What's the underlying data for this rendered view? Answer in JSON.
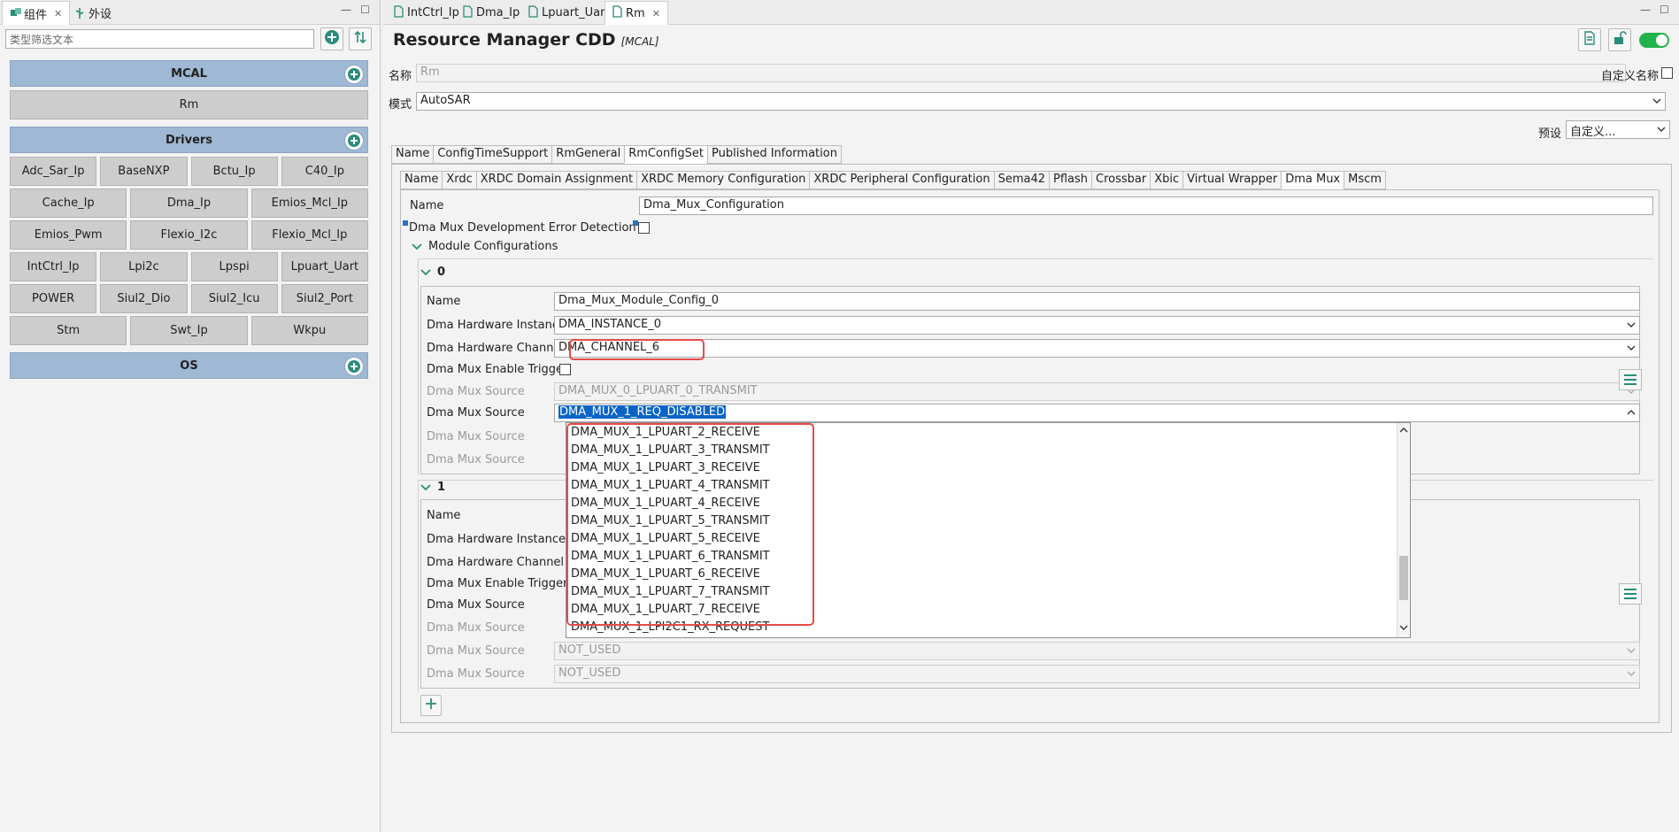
{
  "left_panel": {
    "tabs": [
      {
        "label": "组件",
        "active": true
      },
      {
        "label": "外设",
        "active": false
      }
    ],
    "filter_placeholder": "类型筛选文本",
    "groups": [
      {
        "label": "MCAL",
        "items": [
          [
            "Rm"
          ]
        ]
      },
      {
        "label": "Drivers",
        "items": [
          [
            "Adc_Sar_Ip",
            "BaseNXP",
            "Bctu_Ip",
            "C40_Ip"
          ],
          [
            "Cache_Ip",
            "Dma_Ip",
            "Emios_Mcl_Ip"
          ],
          [
            "Emios_Pwm",
            "Flexio_I2c",
            "Flexio_Mcl_Ip"
          ],
          [
            "IntCtrl_Ip",
            "Lpi2c",
            "Lpspi",
            "Lpuart_Uart"
          ],
          [
            "POWER",
            "Siul2_Dio",
            "Siul2_Icu",
            "Siul2_Port"
          ],
          [
            "Stm",
            "Swt_Ip",
            "Wkpu"
          ]
        ]
      },
      {
        "label": "OS",
        "items": []
      }
    ]
  },
  "editor_tabs": [
    {
      "label": "IntCtrl_Ip",
      "active": false
    },
    {
      "label": "Dma_Ip",
      "active": false
    },
    {
      "label": "Lpuart_Uart",
      "active": false
    },
    {
      "label": "Rm",
      "active": true
    }
  ],
  "header": {
    "title": "Resource Manager CDD",
    "subtitle": "[MCAL]"
  },
  "form": {
    "name_label": "名称",
    "name_value": "Rm",
    "custom_name_label": "自定义名称",
    "mode_label": "模式",
    "mode_value": "AutoSAR",
    "preset_label": "预设",
    "preset_value": "自定义..."
  },
  "outer_tabs": [
    "Name",
    "ConfigTimeSupport",
    "RmGeneral",
    "RmConfigSet",
    "Published Information"
  ],
  "inner_tabs": [
    "Name",
    "Xrdc",
    "XRDC Domain Assignment",
    "XRDC Memory Configuration",
    "XRDC Peripheral Configuration",
    "Sema42",
    "Pflash",
    "Crossbar",
    "Xbic",
    "Virtual Wrapper",
    "Dma Mux",
    "Mscm"
  ],
  "dma_mux": {
    "name_label": "Name",
    "name_value": "Dma_Mux_Configuration",
    "dev_error_label": "Dma Mux Development Error Detection",
    "module_configs_label": "Module Configurations",
    "configs": [
      {
        "index": "0",
        "rows": [
          {
            "label": "Name",
            "value": "Dma_Mux_Module_Config_0"
          },
          {
            "label": "Dma Hardware Instance",
            "value": "DMA_INSTANCE_0"
          },
          {
            "label": "Dma Hardware Channel",
            "value": "DMA_CHANNEL_6"
          },
          {
            "label": "Dma Mux Enable Trigger",
            "value": ""
          },
          {
            "label": "Dma Mux Source",
            "value": "DMA_MUX_0_LPUART_0_TRANSMIT"
          },
          {
            "label": "Dma Mux Source",
            "value": "DMA_MUX_1_REQ_DISABLED"
          },
          {
            "label": "Dma Mux Source",
            "value": ""
          },
          {
            "label": "Dma Mux Source",
            "value": ""
          }
        ]
      },
      {
        "index": "1",
        "rows": [
          {
            "label": "Name",
            "value": ""
          },
          {
            "label": "Dma Hardware Instance",
            "value": ""
          },
          {
            "label": "Dma Hardware Channel",
            "value": ""
          },
          {
            "label": "Dma Mux Enable Trigger",
            "value": ""
          },
          {
            "label": "Dma Mux Source",
            "value": ""
          },
          {
            "label": "Dma Mux Source",
            "value": ""
          },
          {
            "label": "Dma Mux Source",
            "value": "NOT_USED"
          },
          {
            "label": "Dma Mux Source",
            "value": "NOT_USED"
          }
        ]
      }
    ]
  },
  "dropdown_options": [
    "DMA_MUX_1_LPUART_2_RECEIVE",
    "DMA_MUX_1_LPUART_3_TRANSMIT",
    "DMA_MUX_1_LPUART_3_RECEIVE",
    "DMA_MUX_1_LPUART_4_TRANSMIT",
    "DMA_MUX_1_LPUART_4_RECEIVE",
    "DMA_MUX_1_LPUART_5_TRANSMIT",
    "DMA_MUX_1_LPUART_5_RECEIVE",
    "DMA_MUX_1_LPUART_6_TRANSMIT",
    "DMA_MUX_1_LPUART_6_RECEIVE",
    "DMA_MUX_1_LPUART_7_TRANSMIT",
    "DMA_MUX_1_LPUART_7_RECEIVE",
    "DMA_MUX_1_LPI2C1_RX_REQUEST"
  ],
  "colors": {
    "accent": "#2a8c7a",
    "group_header": "#9fb8d3",
    "highlight_box": "#e74a4a",
    "selection": "#0a64c8",
    "toggle": "#22b24c"
  }
}
